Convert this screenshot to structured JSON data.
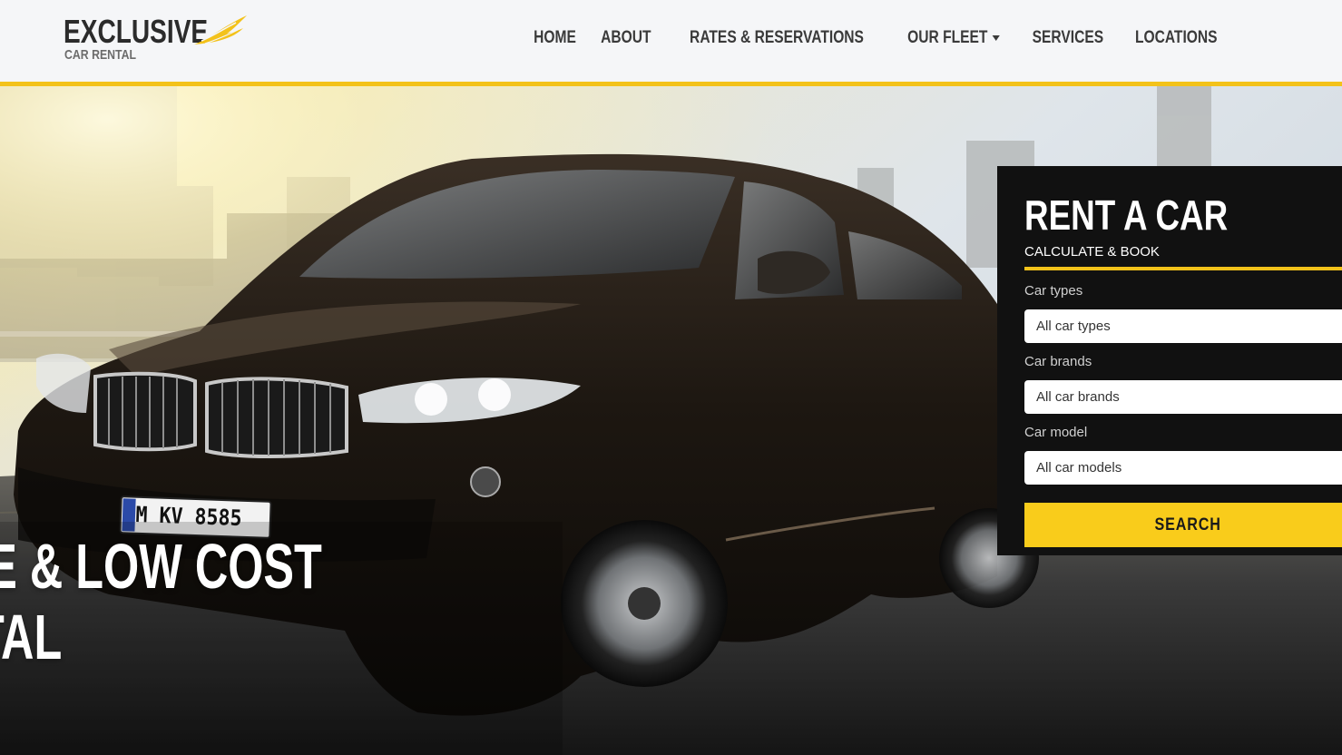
{
  "brand": {
    "name": "EXCLUSIVE",
    "tagline": "CAR RENTAL",
    "logo_icon": "wing-icon",
    "accent": "#f3c21a"
  },
  "nav": {
    "items": [
      {
        "label": "HOME"
      },
      {
        "label": "ABOUT"
      },
      {
        "label": "RATES & RESERVATIONS"
      },
      {
        "label": "OUR FLEET",
        "dropdown": true
      },
      {
        "label": "SERVICES"
      },
      {
        "label": "LOCATIONS"
      }
    ],
    "dropdown_icon": "chevron-down-icon"
  },
  "hero": {
    "headline_line1": "SIVE & LOW COST",
    "headline_line2": "ENTAL",
    "license_plate": "M KV 8585"
  },
  "booking": {
    "title": "RENT A CAR",
    "subtitle": "CALCULATE & BOOK",
    "fields": [
      {
        "label": "Car types",
        "value": "All car types"
      },
      {
        "label": "Car brands",
        "value": "All car brands"
      },
      {
        "label": "Car model",
        "value": "All car models"
      }
    ],
    "search_label": "SEARCH",
    "button_color": "#f9cc1b",
    "panel_color": "#111111"
  }
}
